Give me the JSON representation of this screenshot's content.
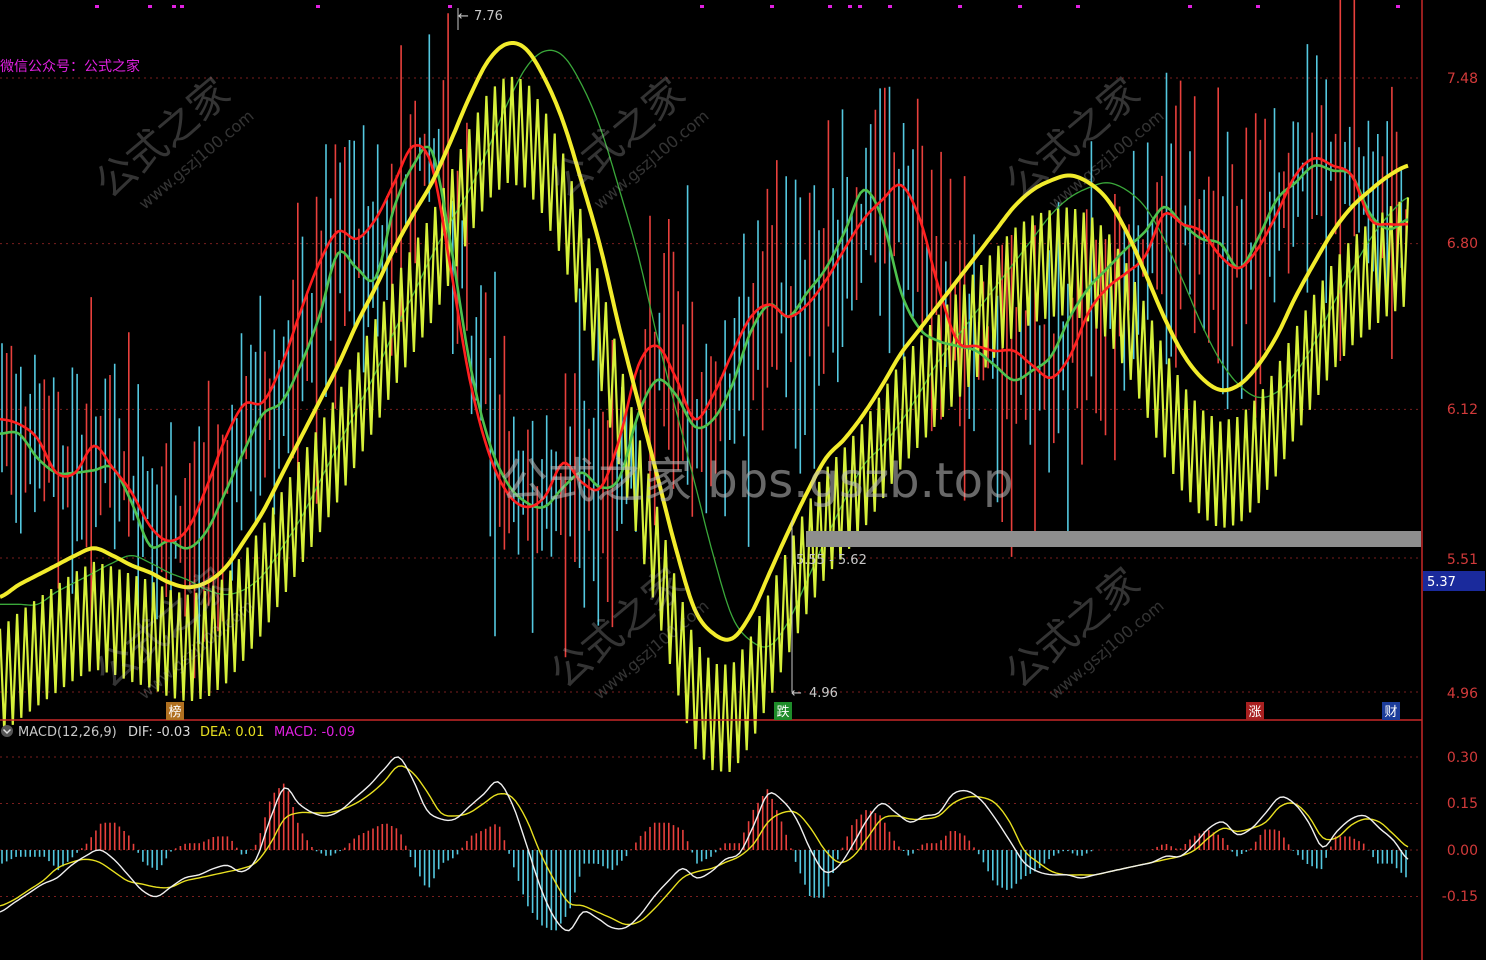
{
  "watermark": {
    "header_label": "微信公众号：公式之家",
    "center_text": "公式之家 bbs.gszb.top",
    "tile_main": "公式之家",
    "tile_sub": "www.gszj100.com"
  },
  "price_axis": {
    "ticks": [
      "7.48",
      "6.80",
      "6.12",
      "5.51",
      "4.96"
    ],
    "current_price": "5.37"
  },
  "annotations": {
    "high": "7.76",
    "low": "4.96",
    "range_band": "5.55 - 5.62"
  },
  "markers": [
    "榜",
    "跌",
    "涨",
    "财"
  ],
  "macd": {
    "title": "MACD(12,26,9)",
    "dif_label": "DIF: -0.03",
    "dea_label": "DEA: 0.01",
    "macd_label": "MACD: -0.09",
    "ticks": [
      "0.30",
      "0.15",
      "0.00",
      "-0.15"
    ]
  },
  "colors": {
    "up": "#e8403c",
    "down": "#54c8e0",
    "line_yellow": "#f2ec2c",
    "line_red": "#ff2020",
    "line_green": "#4ec24e",
    "band_yellowgreen": "#d6f03a",
    "axis_red": "#c82828",
    "macd_title": "#c8c8c8",
    "dea_yellow": "#e8e020",
    "macd_magenta": "#e020e0",
    "current_box": "#1a2a9c"
  },
  "chart_data": [
    {
      "type": "line",
      "title": "",
      "ylim": [
        4.96,
        7.76
      ],
      "y_ticks": [
        7.48,
        6.8,
        6.12,
        5.51,
        4.96
      ],
      "series": [
        {
          "values": [
            5.35,
            5.4,
            5.44,
            5.48,
            5.52,
            5.55,
            5.52,
            5.48,
            5.45,
            5.41,
            5.39,
            5.41,
            5.47,
            5.58,
            5.7,
            5.85,
            6.0,
            6.15,
            6.3,
            6.47,
            6.62,
            6.78,
            6.92,
            7.05,
            7.22,
            7.4,
            7.55,
            7.62,
            7.6,
            7.48,
            7.3,
            7.05,
            6.78,
            6.45,
            6.15,
            5.85,
            5.55,
            5.3,
            5.2,
            5.18,
            5.28,
            5.45,
            5.62,
            5.78,
            5.92,
            6.0,
            6.1,
            6.22,
            6.35,
            6.45,
            6.55,
            6.65,
            6.75,
            6.85,
            6.95,
            7.02,
            7.06,
            7.08,
            7.05,
            6.98,
            6.85,
            6.68,
            6.5,
            6.35,
            6.25,
            6.2,
            6.22,
            6.3,
            6.42,
            6.58,
            6.72,
            6.85,
            6.95,
            7.02,
            7.08,
            7.12
          ]
        },
        {
          "values": [
            6.08,
            6.06,
            6.0,
            5.86,
            5.86,
            5.97,
            5.88,
            5.78,
            5.64,
            5.58,
            5.63,
            5.8,
            6.0,
            6.14,
            6.15,
            6.3,
            6.52,
            6.72,
            6.85,
            6.82,
            6.9,
            7.05,
            7.2,
            7.12,
            6.7,
            6.25,
            5.95,
            5.78,
            5.72,
            5.76,
            5.9,
            5.82,
            5.8,
            6.0,
            6.3,
            6.38,
            6.25,
            6.08,
            6.18,
            6.35,
            6.5,
            6.55,
            6.5,
            6.55,
            6.65,
            6.78,
            6.9,
            6.98,
            7.04,
            6.9,
            6.62,
            6.4,
            6.38,
            6.36,
            6.36,
            6.3,
            6.25,
            6.34,
            6.52,
            6.62,
            6.68,
            6.75,
            6.92,
            6.88,
            6.85,
            6.75,
            6.7,
            6.78,
            6.92,
            7.08,
            7.15,
            7.12,
            7.08,
            6.9,
            6.88,
            6.88
          ]
        },
        {
          "values": [
            6.02,
            6.02,
            5.92,
            5.86,
            5.86,
            5.87,
            5.88,
            5.74,
            5.56,
            5.58,
            5.55,
            5.62,
            5.78,
            5.95,
            6.1,
            6.15,
            6.3,
            6.5,
            6.76,
            6.7,
            6.66,
            6.95,
            7.12,
            7.18,
            6.8,
            6.32,
            6.0,
            5.82,
            5.74,
            5.72,
            5.8,
            5.86,
            5.8,
            5.84,
            6.1,
            6.24,
            6.18,
            6.05,
            6.08,
            6.22,
            6.44,
            6.55,
            6.5,
            6.6,
            6.7,
            6.85,
            7.02,
            6.9,
            6.6,
            6.45,
            6.4,
            6.38,
            6.36,
            6.3,
            6.24,
            6.28,
            6.34,
            6.5,
            6.62,
            6.7,
            6.78,
            6.85,
            6.95,
            6.88,
            6.82,
            6.8,
            6.7,
            6.82,
            6.98,
            7.05,
            7.12,
            7.1,
            7.08,
            6.92,
            6.86,
            6.9
          ]
        }
      ]
    },
    {
      "type": "bar",
      "title": "MACD(12,26,9)",
      "ylim": [
        -0.26,
        0.33
      ],
      "y_ticks": [
        0.3,
        0.15,
        0.0,
        -0.15
      ],
      "series": [
        {
          "name": "DIF",
          "values": [
            -0.2,
            -0.17,
            -0.14,
            -0.11,
            -0.09,
            -0.05,
            -0.02,
            0.0,
            -0.03,
            -0.08,
            -0.13,
            -0.15,
            -0.12,
            -0.09,
            -0.08,
            -0.06,
            -0.05,
            -0.07,
            -0.03,
            0.1,
            0.2,
            0.15,
            0.12,
            0.11,
            0.13,
            0.17,
            0.21,
            0.26,
            0.3,
            0.23,
            0.13,
            0.1,
            0.1,
            0.14,
            0.18,
            0.22,
            0.15,
            0.02,
            -0.12,
            -0.22,
            -0.26,
            -0.2,
            -0.22,
            -0.25,
            -0.25,
            -0.21,
            -0.15,
            -0.1,
            -0.06,
            -0.09,
            -0.07,
            -0.03,
            -0.01,
            0.08,
            0.18,
            0.16,
            0.1,
            0.0,
            -0.07,
            -0.05,
            0.02,
            0.1,
            0.15,
            0.12,
            0.09,
            0.11,
            0.12,
            0.18,
            0.19,
            0.16,
            0.1,
            0.03,
            -0.04,
            -0.07,
            -0.08,
            -0.08,
            -0.09,
            -0.08,
            -0.07,
            -0.06,
            -0.05,
            -0.04,
            -0.02,
            -0.02,
            0.02,
            0.07,
            0.09,
            0.05,
            0.07,
            0.12,
            0.17,
            0.15,
            0.09,
            0.01,
            0.06,
            0.1,
            0.11,
            0.07,
            0.03,
            -0.03
          ]
        },
        {
          "name": "DEA",
          "values": [
            -0.18,
            -0.16,
            -0.13,
            -0.1,
            -0.06,
            -0.04,
            -0.03,
            -0.04,
            -0.07,
            -0.1,
            -0.11,
            -0.12,
            -0.12,
            -0.1,
            -0.09,
            -0.08,
            -0.07,
            -0.06,
            -0.04,
            0.02,
            0.1,
            0.12,
            0.12,
            0.12,
            0.13,
            0.15,
            0.18,
            0.22,
            0.27,
            0.25,
            0.19,
            0.12,
            0.11,
            0.12,
            0.15,
            0.18,
            0.17,
            0.1,
            -0.01,
            -0.1,
            -0.17,
            -0.18,
            -0.2,
            -0.22,
            -0.24,
            -0.23,
            -0.19,
            -0.14,
            -0.09,
            -0.07,
            -0.06,
            -0.04,
            -0.02,
            0.02,
            0.09,
            0.12,
            0.12,
            0.07,
            0.0,
            -0.04,
            -0.02,
            0.04,
            0.1,
            0.11,
            0.1,
            0.1,
            0.11,
            0.15,
            0.17,
            0.17,
            0.15,
            0.09,
            0.0,
            -0.04,
            -0.07,
            -0.08,
            -0.08,
            -0.08,
            -0.07,
            -0.06,
            -0.05,
            -0.04,
            -0.03,
            -0.02,
            0.0,
            0.04,
            0.07,
            0.06,
            0.07,
            0.09,
            0.14,
            0.15,
            0.11,
            0.04,
            0.04,
            0.08,
            0.1,
            0.09,
            0.05,
            0.01
          ]
        }
      ]
    }
  ]
}
